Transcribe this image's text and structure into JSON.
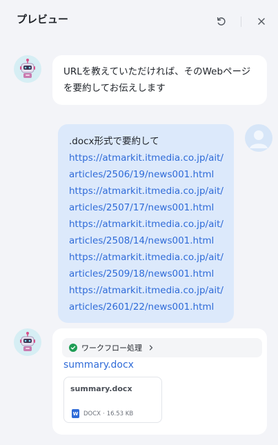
{
  "header": {
    "title": "プレビュー",
    "refresh_icon": "refresh-icon",
    "close_icon": "close-icon"
  },
  "messages": [
    {
      "role": "bot",
      "text": "URLを教えていただければ、そのWebページを要約してお伝えします"
    },
    {
      "role": "user",
      "text": ".docx形式で要約して",
      "urls": [
        "https://atmarkit.itmedia.co.jp/ait/articles/2506/19/news001.html",
        "https://atmarkit.itmedia.co.jp/ait/articles/2507/17/news001.html",
        "https://atmarkit.itmedia.co.jp/ait/articles/2508/14/news001.html",
        "https://atmarkit.itmedia.co.jp/ait/articles/2509/18/news001.html",
        "https://atmarkit.itmedia.co.jp/ait/articles/2601/22/news001.html"
      ]
    },
    {
      "role": "bot",
      "workflow_label": "ワークフロー処理",
      "file_link": "summary.docx",
      "file_card": {
        "name": "summary.docx",
        "type": "DOCX",
        "separator": "·",
        "size": "16.53 KB"
      }
    }
  ],
  "colors": {
    "accent": "#2f6bd8",
    "user_bubble": "#dce9fb",
    "background": "#f3f4f8",
    "success": "#1f9d55"
  }
}
